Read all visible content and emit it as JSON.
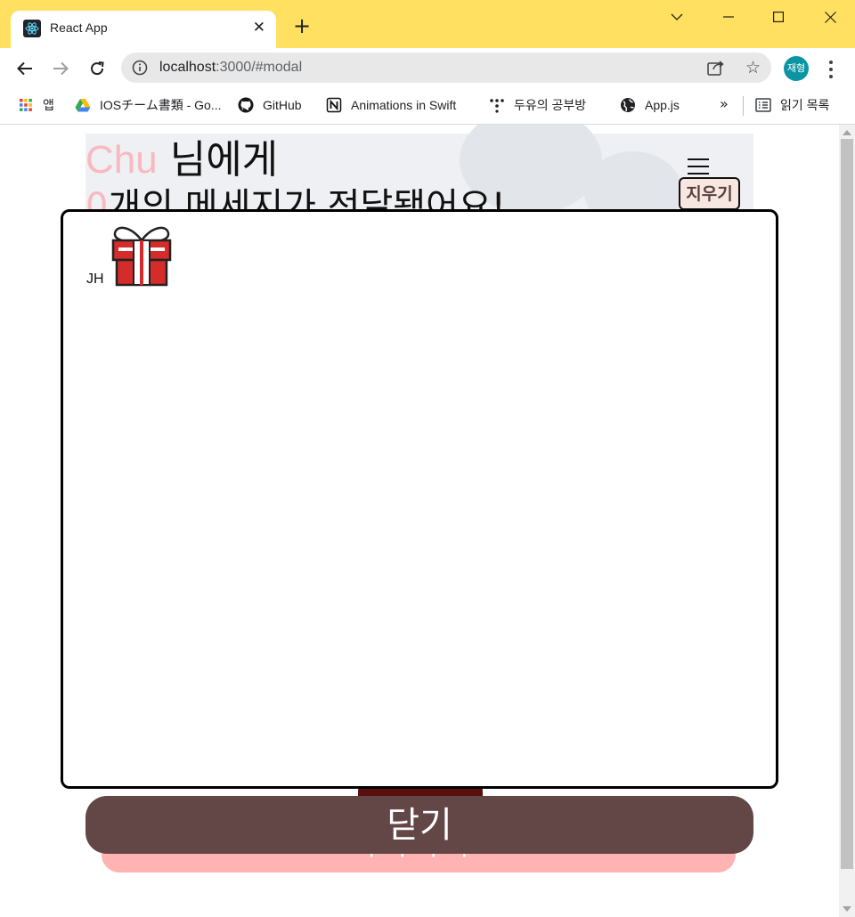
{
  "browser": {
    "tab_title": "React App",
    "tab_close": "✕",
    "new_tab": "+",
    "url_host": "localhost",
    "url_path": ":3000/#modal",
    "star": "☆",
    "profile_initials": "재형",
    "theme_color": "#ffe060"
  },
  "bookmarks": {
    "items": [
      {
        "label": "앱",
        "icon": "apps-grid-icon"
      },
      {
        "label": "IOSチーム書類 - Go...",
        "icon": "google-drive-icon"
      },
      {
        "label": "GitHub",
        "icon": "github-icon"
      },
      {
        "label": "Animations in Swift",
        "icon": "notion-icon"
      },
      {
        "label": "두유의 공부방",
        "icon": "dots-icon"
      },
      {
        "label": "App.js",
        "icon": "globe-icon"
      }
    ],
    "more": "»",
    "reading_list": "읽기 목록"
  },
  "page": {
    "nickname": "Chu",
    "greeting_suffix": "님에게",
    "message_count": "0",
    "message_count_suffix": "개의 메세지가 전달됐어요!",
    "erase_label": "지우기",
    "pink_button_label": "ㅏ ㅏ ㅏ ㅏ",
    "accent_pink": "#f8b9c1",
    "button_brown": "#634646"
  },
  "modal": {
    "messages": [
      {
        "sender": "JH",
        "icon": "gift-icon"
      }
    ],
    "close_label": "닫기"
  }
}
